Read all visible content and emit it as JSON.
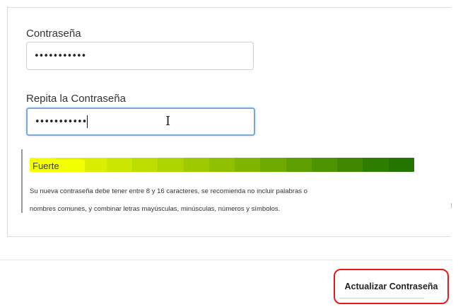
{
  "form": {
    "password_label": "Contraseña",
    "password_value": "•••••••••••",
    "repeat_label": "Repita la Contraseña",
    "repeat_value": "•••••••••••"
  },
  "strength": {
    "level_label": "Fuerte",
    "level_fraction": 1.0,
    "gradient_colors": [
      "#f4ff00",
      "#e6f400",
      "#d9ee00",
      "#cbe600",
      "#bcdd00",
      "#aed300",
      "#9fca00",
      "#90c000",
      "#80b500",
      "#70aa00",
      "#5f9e00",
      "#4f9300",
      "#3f8800",
      "#2f7e00",
      "#237500"
    ],
    "hint_line_1": "Su nueva contraseña debe tener entre 8 y 16 caracteres, se recomienda no incluir palabras o",
    "hint_line_2": "nombres comunes, y combinar letras mayúsculas, minúsculas, números y símbolos."
  },
  "actions": {
    "update_label": "Actualizar Contraseña",
    "highlight_color": "#e31b1b"
  }
}
